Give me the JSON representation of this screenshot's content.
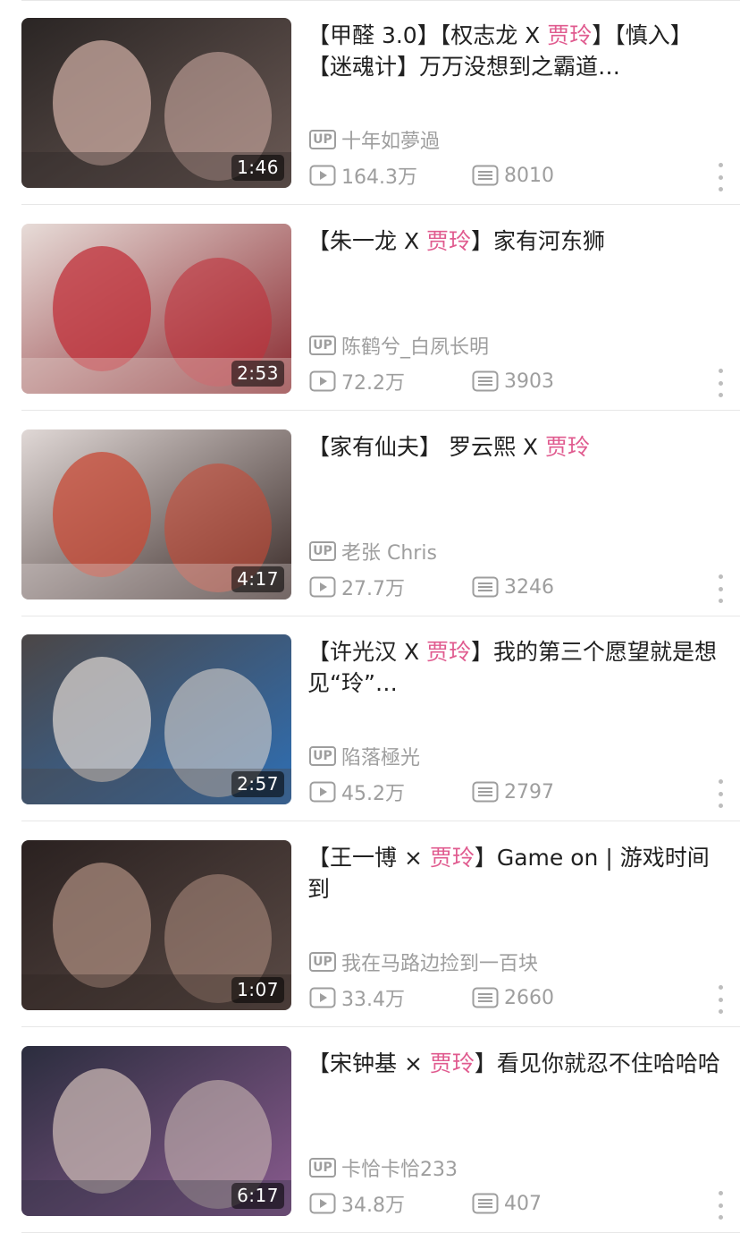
{
  "items": [
    {
      "title_parts": [
        "【甲醛 3.0】【权志龙 X ",
        "贾玲",
        "】【慎入】【迷魂计】万万没想到之霸道…"
      ],
      "uploader": "十年如夢過",
      "views": "164.3万",
      "danmaku": "8010",
      "duration": "1:46",
      "thumb_colors": [
        "#2a2524",
        "#c9a9a0",
        "#6b5a55"
      ]
    },
    {
      "title_parts": [
        "【朱一龙 X ",
        "贾玲",
        "】家有河东狮"
      ],
      "uploader": "陈鹤兮_白夙长明",
      "views": "72.2万",
      "danmaku": "3903",
      "duration": "2:53",
      "thumb_colors": [
        "#e7dcd8",
        "#c0303a",
        "#8a2a30"
      ]
    },
    {
      "title_parts": [
        "【家有仙夫】  罗云熙 X ",
        "贾玲",
        ""
      ],
      "uploader": "老张 Chris",
      "views": "27.7万",
      "danmaku": "3246",
      "duration": "4:17",
      "thumb_colors": [
        "#e0d8d6",
        "#c84a35",
        "#3a2b28"
      ]
    },
    {
      "title_parts": [
        "【许光汉 X ",
        "贾玲",
        "】我的第三个愿望就是想见“玲”…"
      ],
      "uploader": "陷落極光",
      "views": "45.2万",
      "danmaku": "2797",
      "duration": "2:57",
      "thumb_colors": [
        "#4b4646",
        "#d8d2cd",
        "#2e6fb5"
      ]
    },
    {
      "title_parts": [
        "【王一博 × ",
        "贾玲",
        "】Game on | 游戏时间到"
      ],
      "uploader": "我在马路边捡到一百块",
      "views": "33.4万",
      "danmaku": "2660",
      "duration": "1:07",
      "thumb_colors": [
        "#2a2120",
        "#a8897c",
        "#5a4a45"
      ]
    },
    {
      "title_parts": [
        "【宋钟基 × ",
        "贾玲",
        "】看见你就忍不住哈哈哈"
      ],
      "uploader": "卡恰卡恰233",
      "views": "34.8万",
      "danmaku": "407",
      "duration": "6:17",
      "thumb_colors": [
        "#2b2d3e",
        "#c9b7b3",
        "#8a5b8f"
      ]
    }
  ],
  "badge_label": "UP",
  "colors": {
    "highlight": "#e05b8f",
    "meta": "#9e9e9e",
    "divider": "#e7e7e7"
  }
}
